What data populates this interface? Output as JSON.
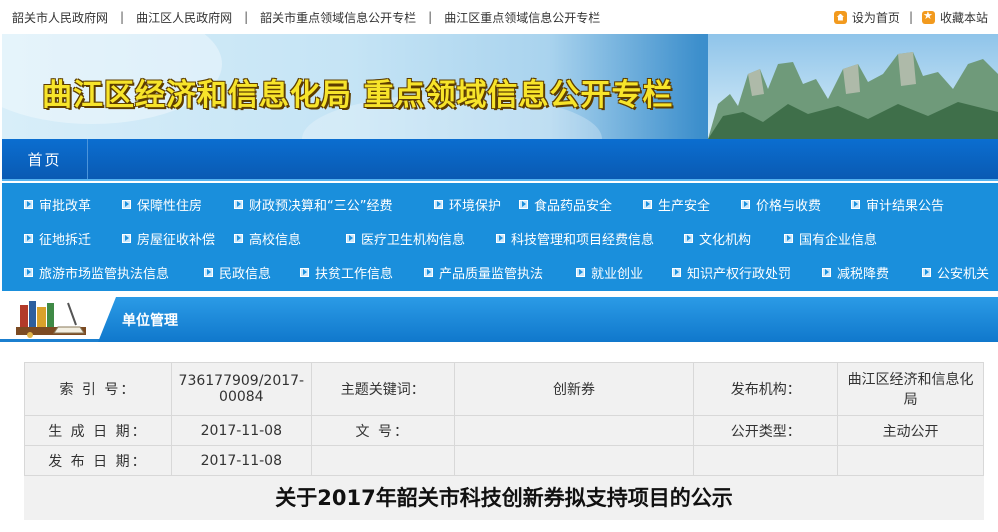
{
  "topbar": {
    "links": [
      "韶关市人民政府网",
      "曲江区人民政府网",
      "韶关市重点领域信息公开专栏",
      "曲江区重点领域信息公开专栏"
    ],
    "separator": "|",
    "set_home": "设为首页",
    "bookmark": "收藏本站"
  },
  "banner": {
    "title": "曲江区经济和信息化局 重点领域信息公开专栏"
  },
  "nav": {
    "home": "首页"
  },
  "categories": [
    [
      "审批改革",
      "保障性住房",
      "财政预决算和“三公”经费",
      "环境保护",
      "食品药品安全",
      "生产安全",
      "价格与收费",
      "审计结果公告"
    ],
    [
      "征地拆迁",
      "房屋征收补偿",
      "高校信息",
      "医疗卫生机构信息",
      "科技管理和项目经费信息",
      "文化机构",
      "国有企业信息"
    ],
    [
      "旅游市场监管执法信息",
      "民政信息",
      "扶贫工作信息",
      "产品质量监管执法",
      "就业创业",
      "知识产权行政处罚",
      "减税降费",
      "公安机关"
    ]
  ],
  "section": {
    "title": "单位管理"
  },
  "info": {
    "index_label": "索 引 号：",
    "index_value": "736177909/2017-00084",
    "keyword_label": "主题关键词：",
    "keyword_value": "创新券",
    "publisher_label": "发布机构：",
    "publisher_value": "曲江区经济和信息化局",
    "gen_date_label": "生 成 日 期：",
    "gen_date_value": "2017-11-08",
    "doc_no_label": "文 号：",
    "doc_no_value": "",
    "open_type_label": "公开类型：",
    "open_type_value": "主动公开",
    "pub_date_label": "发 布 日 期：",
    "pub_date_value": "2017-11-08"
  },
  "document": {
    "title": "关于2017年韶关市科技创新券拟支持项目的公示"
  },
  "colors": {
    "nav_blue": "#0a5ab3",
    "category_blue": "#1a8fdc",
    "banner_title": "#f7e42a",
    "accent_orange": "#f29a1e"
  }
}
